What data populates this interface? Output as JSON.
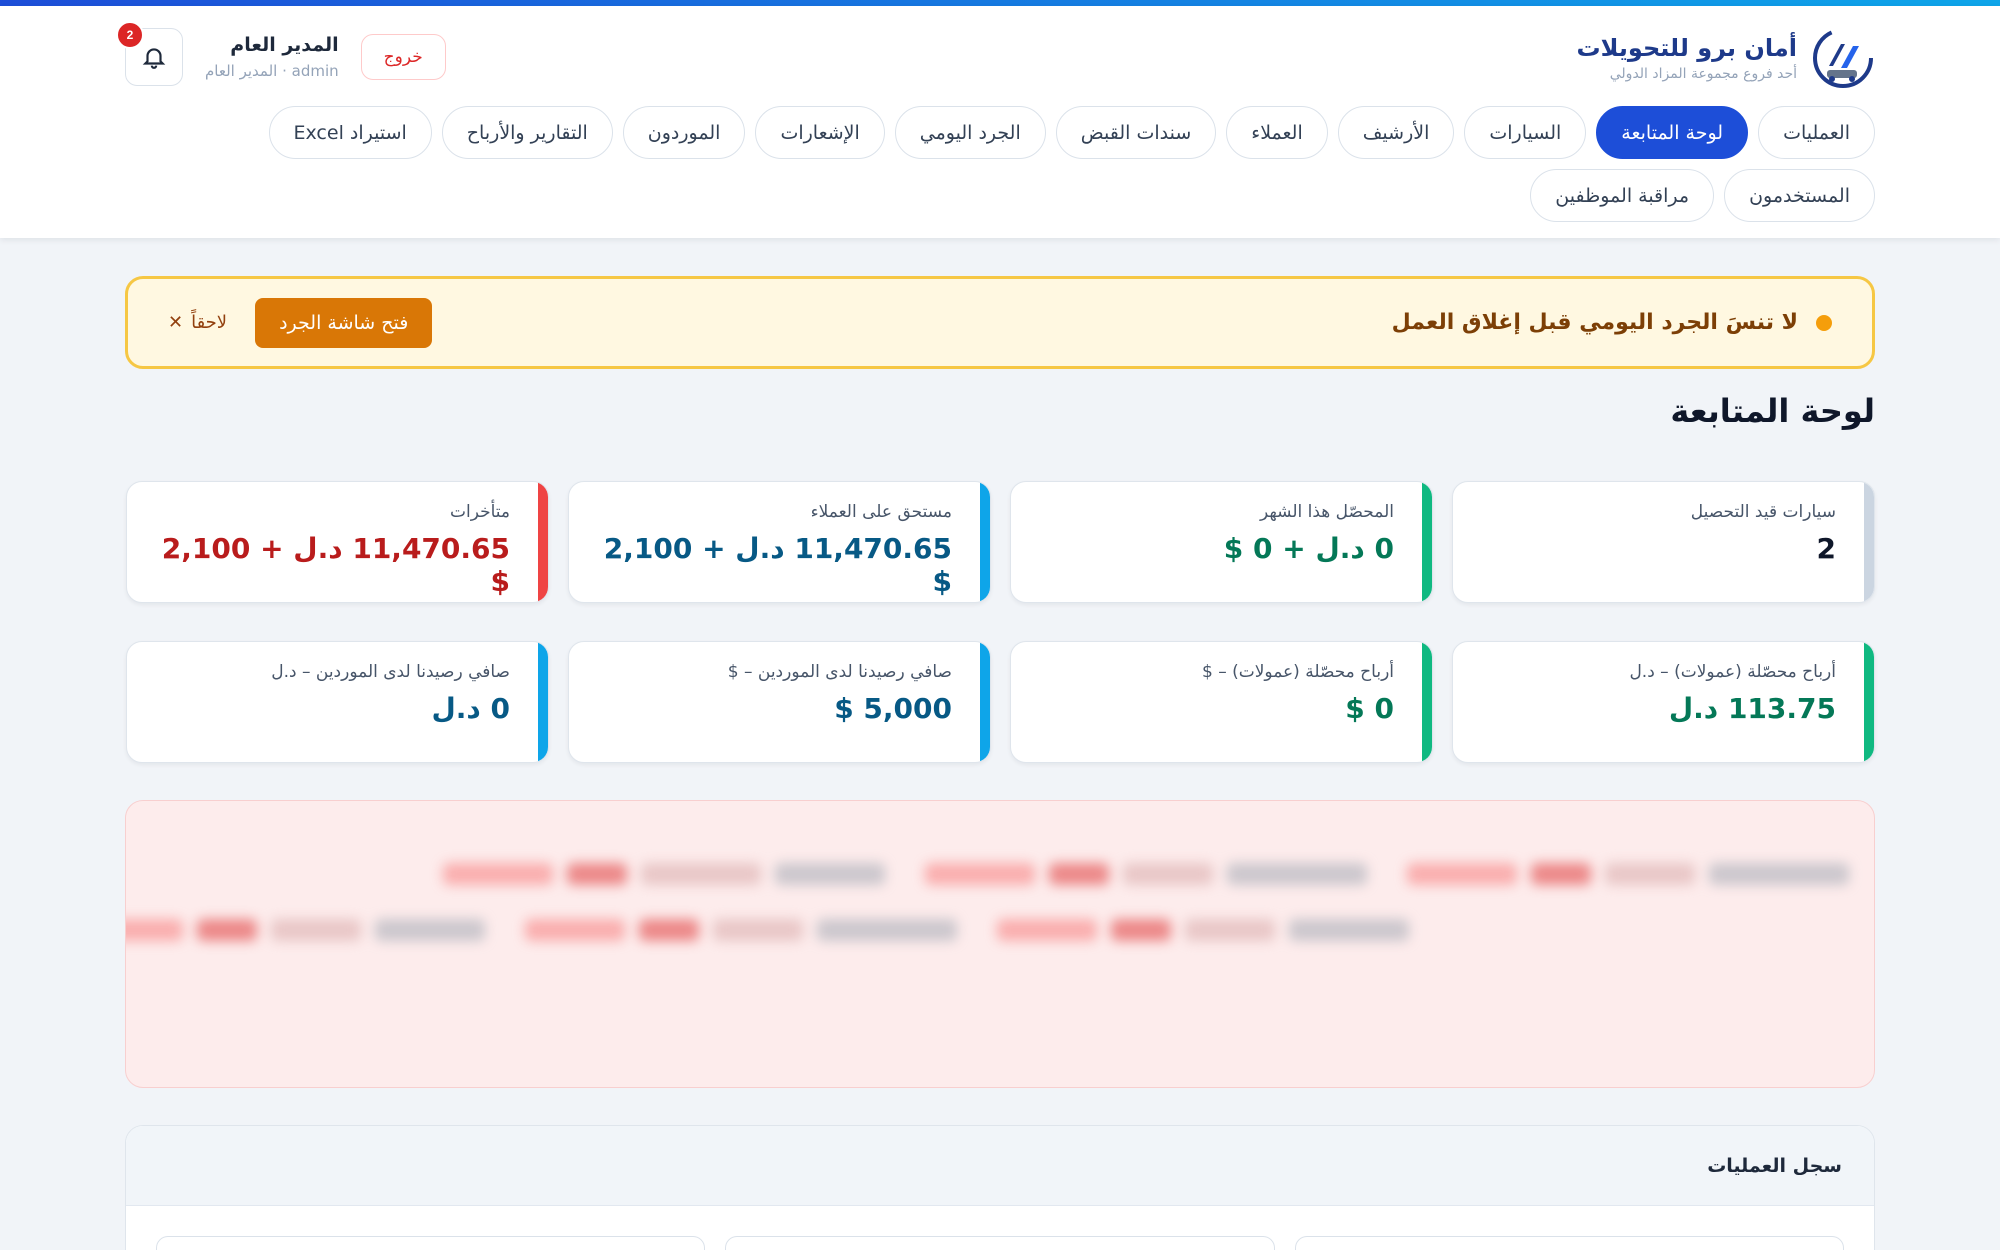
{
  "brand": {
    "title": "أمان برو للتحويلات",
    "subtitle": "أحد فروع مجموعة المزاد الدولي"
  },
  "user": {
    "name": "المدير العام",
    "role_line": "admin · المدير العام",
    "logout_label": "خروج",
    "notifications_count": "2"
  },
  "nav": {
    "tabs": [
      {
        "label": "العمليات",
        "active": false
      },
      {
        "label": "لوحة المتابعة",
        "active": true
      },
      {
        "label": "السيارات",
        "active": false
      },
      {
        "label": "الأرشيف",
        "active": false
      },
      {
        "label": "العملاء",
        "active": false
      },
      {
        "label": "سندات القبض",
        "active": false
      },
      {
        "label": "الجرد اليومي",
        "active": false
      },
      {
        "label": "الإشعارات",
        "active": false
      },
      {
        "label": "الموردون",
        "active": false
      },
      {
        "label": "التقارير والأرباح",
        "active": false
      },
      {
        "label": "استيراد Excel",
        "active": false
      },
      {
        "label": "المستخدمون",
        "active": false
      },
      {
        "label": "مراقبة الموظفين",
        "active": false
      }
    ]
  },
  "reminder": {
    "message": "لا تنسَ الجرد اليومي قبل إغلاق العمل",
    "open_label": "فتح شاشة الجرد",
    "later_label": "لاحقاً",
    "close_glyph": "✕"
  },
  "page_title": "لوحة المتابعة",
  "stats": {
    "cards": [
      {
        "label": "سيارات قيد التحصيل",
        "value": "2",
        "accent": "#cbd5e1",
        "value_color": "#0f172a"
      },
      {
        "label": "المحصّل هذا الشهر",
        "value": "0 د.ل + 0 $",
        "accent": "#10b981",
        "value_color": "#047857"
      },
      {
        "label": "مستحق على العملاء",
        "value": "11,470.65 د.ل + 2,100 $",
        "accent": "#0ea5e9",
        "value_color": "#075985"
      },
      {
        "label": "متأخرات",
        "value": "11,470.65 د.ل + 2,100 $",
        "accent": "#ef4444",
        "value_color": "#b91c1c"
      },
      {
        "label": "أرباح محصّلة (عمولات) – د.ل",
        "value": "113.75 د.ل",
        "accent": "#10b981",
        "value_color": "#047857"
      },
      {
        "label": "أرباح محصّلة (عمولات) – $",
        "value": "0 $",
        "accent": "#10b981",
        "value_color": "#047857"
      },
      {
        "label": "صافي رصيدنا لدى الموردين – $",
        "value": "5,000 $",
        "accent": "#0ea5e9",
        "value_color": "#075985"
      },
      {
        "label": "صافي رصيدنا لدى الموردين – د.ل",
        "value": "0 د.ل",
        "accent": "#0ea5e9",
        "value_color": "#075985"
      }
    ]
  },
  "log": {
    "title": "سجل العمليات"
  },
  "colors": {
    "primary": "#1d4ed8",
    "warning": "#d97706",
    "danger": "#dc2626",
    "success": "#10b981"
  }
}
